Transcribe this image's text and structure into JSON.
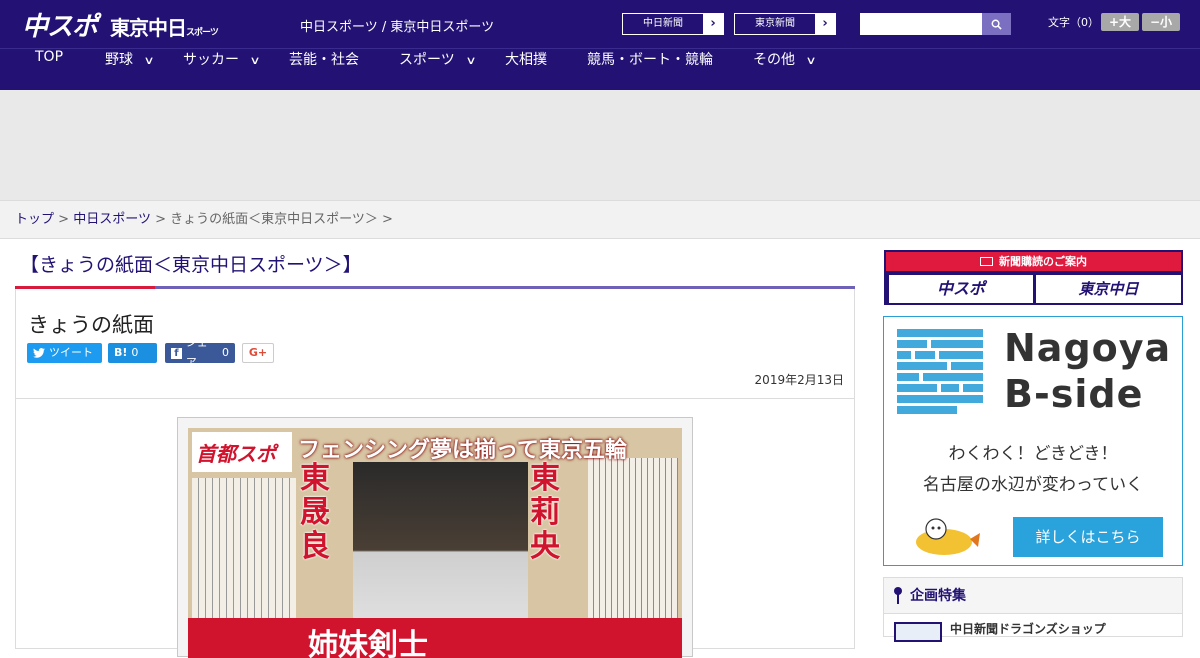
{
  "header": {
    "logo_chuspo": "中スポ",
    "logo_tokyo": "東京中日",
    "logo_tokyo_suffix": "スポーツ",
    "site_name": "中日スポーツ / 東京中日スポーツ",
    "paper_links": [
      {
        "label": "中日新聞"
      },
      {
        "label": "東京新聞"
      }
    ],
    "search": {
      "placeholder": "",
      "value": ""
    },
    "font_size_label": "文字（0）",
    "font_larger": "+大",
    "font_smaller": "−小"
  },
  "nav": {
    "items": [
      {
        "label": "TOP",
        "has_submenu": false
      },
      {
        "label": "野球",
        "has_submenu": true
      },
      {
        "label": "サッカー",
        "has_submenu": true
      },
      {
        "label": "芸能・社会",
        "has_submenu": false
      },
      {
        "label": "スポーツ",
        "has_submenu": true
      },
      {
        "label": "大相撲",
        "has_submenu": false
      },
      {
        "label": "競馬・ボート・競輪",
        "has_submenu": false
      },
      {
        "label": "その他",
        "has_submenu": true
      }
    ]
  },
  "breadcrumb": {
    "home": "トップ",
    "section": "中日スポーツ",
    "current": "きょうの紙面＜東京中日スポーツ＞",
    "sep": ">"
  },
  "section_title": "【きょうの紙面＜東京中日スポーツ＞】",
  "article": {
    "title": "きょうの紙面",
    "share": {
      "tweet": "ツイート",
      "hatena": "B!",
      "hatena_count": "0",
      "facebook": "シェア",
      "facebook_count": "0",
      "gplus": "G+"
    },
    "date": "2019年2月13日",
    "paper_image": {
      "logo": "首都スポ",
      "headline": "フェンシング夢は揃って東京五輪",
      "name_left": "東晟良",
      "name_right": "東莉央",
      "bottom_text": "姉妹剣士"
    }
  },
  "sidebar": {
    "subscription": {
      "header": "新聞購読のご案内",
      "chuspo": "中スポ",
      "tokyo": "東京中日"
    },
    "bside": {
      "title_line1": "Nagoya",
      "title_line2": "B-side",
      "copy_line1": "わくわく！どきどき！",
      "copy_line2": "名古屋の水辺が変わっていく",
      "cta": "詳しくはこちら"
    },
    "features": {
      "heading": "企画特集",
      "first_item": "中日新聞ドラゴンズショップ"
    }
  },
  "colors": {
    "brand_navy": "#231274",
    "accent_purple": "#6e62b8",
    "accent_red": "#d81b3c",
    "bside_blue": "#2aa2dc"
  }
}
